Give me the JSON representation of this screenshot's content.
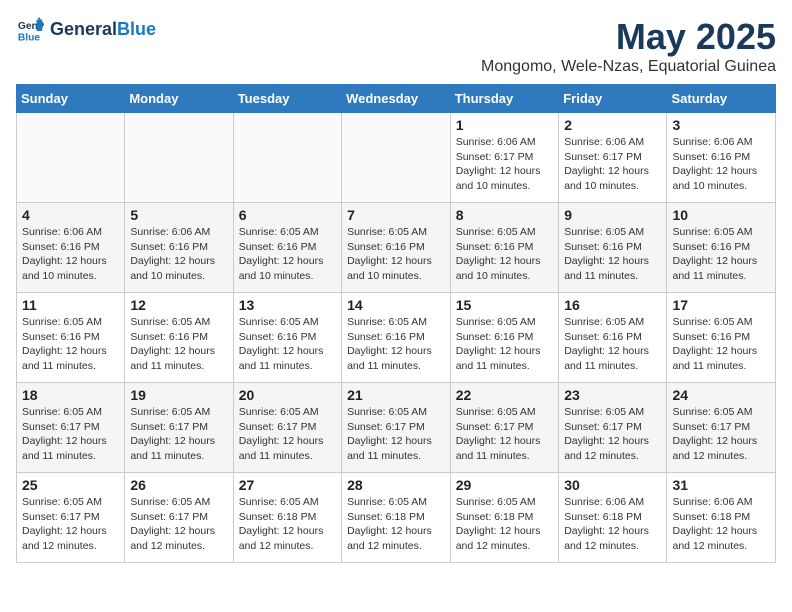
{
  "logo": {
    "line1": "General",
    "line2": "Blue"
  },
  "title": "May 2025",
  "subtitle": "Mongomo, Wele-Nzas, Equatorial Guinea",
  "days_header": [
    "Sunday",
    "Monday",
    "Tuesday",
    "Wednesday",
    "Thursday",
    "Friday",
    "Saturday"
  ],
  "weeks": [
    [
      {
        "day": "",
        "info": ""
      },
      {
        "day": "",
        "info": ""
      },
      {
        "day": "",
        "info": ""
      },
      {
        "day": "",
        "info": ""
      },
      {
        "day": "1",
        "info": "Sunrise: 6:06 AM\nSunset: 6:17 PM\nDaylight: 12 hours\nand 10 minutes."
      },
      {
        "day": "2",
        "info": "Sunrise: 6:06 AM\nSunset: 6:17 PM\nDaylight: 12 hours\nand 10 minutes."
      },
      {
        "day": "3",
        "info": "Sunrise: 6:06 AM\nSunset: 6:16 PM\nDaylight: 12 hours\nand 10 minutes."
      }
    ],
    [
      {
        "day": "4",
        "info": "Sunrise: 6:06 AM\nSunset: 6:16 PM\nDaylight: 12 hours\nand 10 minutes."
      },
      {
        "day": "5",
        "info": "Sunrise: 6:06 AM\nSunset: 6:16 PM\nDaylight: 12 hours\nand 10 minutes."
      },
      {
        "day": "6",
        "info": "Sunrise: 6:05 AM\nSunset: 6:16 PM\nDaylight: 12 hours\nand 10 minutes."
      },
      {
        "day": "7",
        "info": "Sunrise: 6:05 AM\nSunset: 6:16 PM\nDaylight: 12 hours\nand 10 minutes."
      },
      {
        "day": "8",
        "info": "Sunrise: 6:05 AM\nSunset: 6:16 PM\nDaylight: 12 hours\nand 10 minutes."
      },
      {
        "day": "9",
        "info": "Sunrise: 6:05 AM\nSunset: 6:16 PM\nDaylight: 12 hours\nand 11 minutes."
      },
      {
        "day": "10",
        "info": "Sunrise: 6:05 AM\nSunset: 6:16 PM\nDaylight: 12 hours\nand 11 minutes."
      }
    ],
    [
      {
        "day": "11",
        "info": "Sunrise: 6:05 AM\nSunset: 6:16 PM\nDaylight: 12 hours\nand 11 minutes."
      },
      {
        "day": "12",
        "info": "Sunrise: 6:05 AM\nSunset: 6:16 PM\nDaylight: 12 hours\nand 11 minutes."
      },
      {
        "day": "13",
        "info": "Sunrise: 6:05 AM\nSunset: 6:16 PM\nDaylight: 12 hours\nand 11 minutes."
      },
      {
        "day": "14",
        "info": "Sunrise: 6:05 AM\nSunset: 6:16 PM\nDaylight: 12 hours\nand 11 minutes."
      },
      {
        "day": "15",
        "info": "Sunrise: 6:05 AM\nSunset: 6:16 PM\nDaylight: 12 hours\nand 11 minutes."
      },
      {
        "day": "16",
        "info": "Sunrise: 6:05 AM\nSunset: 6:16 PM\nDaylight: 12 hours\nand 11 minutes."
      },
      {
        "day": "17",
        "info": "Sunrise: 6:05 AM\nSunset: 6:16 PM\nDaylight: 12 hours\nand 11 minutes."
      }
    ],
    [
      {
        "day": "18",
        "info": "Sunrise: 6:05 AM\nSunset: 6:17 PM\nDaylight: 12 hours\nand 11 minutes."
      },
      {
        "day": "19",
        "info": "Sunrise: 6:05 AM\nSunset: 6:17 PM\nDaylight: 12 hours\nand 11 minutes."
      },
      {
        "day": "20",
        "info": "Sunrise: 6:05 AM\nSunset: 6:17 PM\nDaylight: 12 hours\nand 11 minutes."
      },
      {
        "day": "21",
        "info": "Sunrise: 6:05 AM\nSunset: 6:17 PM\nDaylight: 12 hours\nand 11 minutes."
      },
      {
        "day": "22",
        "info": "Sunrise: 6:05 AM\nSunset: 6:17 PM\nDaylight: 12 hours\nand 11 minutes."
      },
      {
        "day": "23",
        "info": "Sunrise: 6:05 AM\nSunset: 6:17 PM\nDaylight: 12 hours\nand 12 minutes."
      },
      {
        "day": "24",
        "info": "Sunrise: 6:05 AM\nSunset: 6:17 PM\nDaylight: 12 hours\nand 12 minutes."
      }
    ],
    [
      {
        "day": "25",
        "info": "Sunrise: 6:05 AM\nSunset: 6:17 PM\nDaylight: 12 hours\nand 12 minutes."
      },
      {
        "day": "26",
        "info": "Sunrise: 6:05 AM\nSunset: 6:17 PM\nDaylight: 12 hours\nand 12 minutes."
      },
      {
        "day": "27",
        "info": "Sunrise: 6:05 AM\nSunset: 6:18 PM\nDaylight: 12 hours\nand 12 minutes."
      },
      {
        "day": "28",
        "info": "Sunrise: 6:05 AM\nSunset: 6:18 PM\nDaylight: 12 hours\nand 12 minutes."
      },
      {
        "day": "29",
        "info": "Sunrise: 6:05 AM\nSunset: 6:18 PM\nDaylight: 12 hours\nand 12 minutes."
      },
      {
        "day": "30",
        "info": "Sunrise: 6:06 AM\nSunset: 6:18 PM\nDaylight: 12 hours\nand 12 minutes."
      },
      {
        "day": "31",
        "info": "Sunrise: 6:06 AM\nSunset: 6:18 PM\nDaylight: 12 hours\nand 12 minutes."
      }
    ]
  ]
}
